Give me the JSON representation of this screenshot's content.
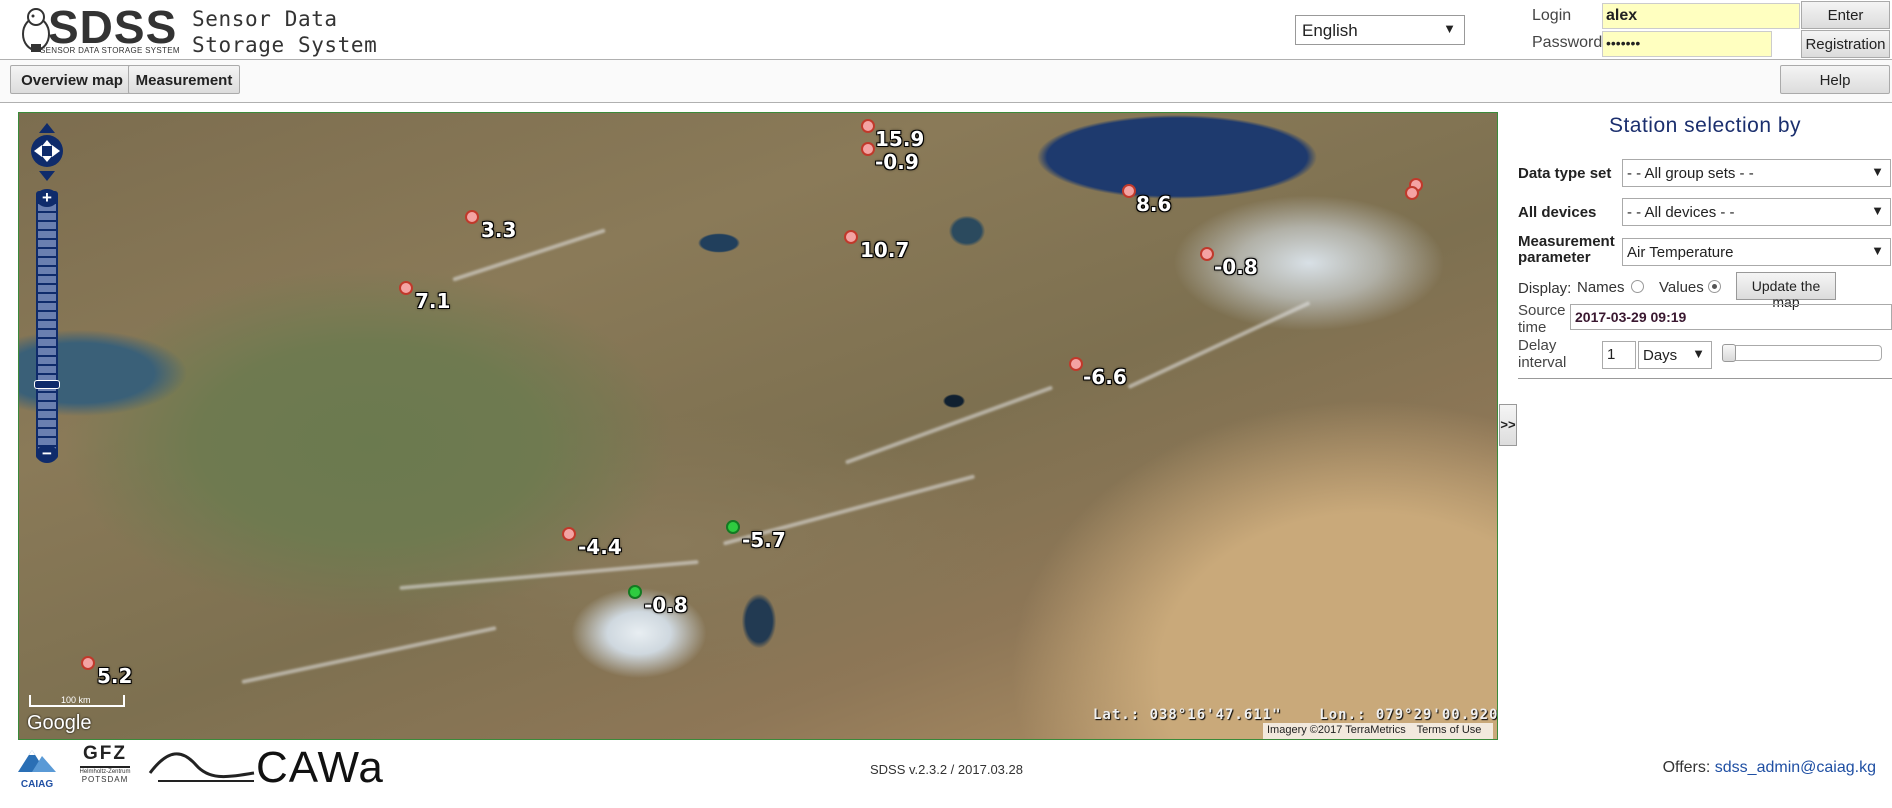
{
  "header": {
    "logo_text": "SDSS",
    "logo_subtext": "SENSOR DATA STORAGE SYSTEM",
    "title_line1": "Sensor Data",
    "title_line2": "Storage System",
    "language": "English",
    "login_label": "Login",
    "password_label": "Password",
    "login_value": "alex",
    "password_value": "•••••••",
    "enter_label": "Enter",
    "registration_label": "Registration"
  },
  "toolbar": {
    "overview_label": "Overview map",
    "measurement_label": "Measurement",
    "help_label": "Help"
  },
  "map": {
    "stations": [
      {
        "value": "15.9",
        "color": "red"
      },
      {
        "value": "-0.9",
        "color": "red"
      },
      {
        "value": "8.6",
        "color": "red"
      },
      {
        "value": "3.3",
        "color": "red"
      },
      {
        "value": "10.7",
        "color": "red"
      },
      {
        "value": "7.1",
        "color": "red"
      },
      {
        "value": "-0.8",
        "color": "red"
      },
      {
        "value": "-6.6",
        "color": "red"
      },
      {
        "value": "-4.4",
        "color": "red"
      },
      {
        "value": "-5.7",
        "color": "green"
      },
      {
        "value": "-0.8",
        "color": "green"
      },
      {
        "value": "5.2",
        "color": "red"
      }
    ],
    "scale_label": "100 km",
    "google_label": "Google",
    "coordinates": "Lat.: 038°16'47.611\"    Lon.: 079°29'00.920\"",
    "imagery": "Imagery ©2017 TerraMetrics",
    "terms": "Terms of Use"
  },
  "panel": {
    "title": "Station selection by",
    "data_type_label": "Data type set",
    "data_type_value": "- - All group sets - -",
    "devices_label": "All devices",
    "devices_value": "- - All devices - -",
    "param_label_1": "Measurement",
    "param_label_2": "parameter",
    "param_value": "Air Temperature",
    "display_label": "Display:",
    "names_label": "Names",
    "values_label": "Values",
    "update_label": "Update the map",
    "source_label_1": "Source",
    "source_label_2": "time",
    "source_value": "2017-03-29 09:19",
    "delay_label_1": "Delay",
    "delay_label_2": "interval",
    "delay_value": "1",
    "delay_unit": "Days",
    "toggle_label": ">>"
  },
  "footer": {
    "caiag_label": "CAIAG",
    "gfz_label": "GFZ",
    "gfz_sub1": "Helmholtz-Zentrum",
    "gfz_sub2": "POTSDAM",
    "cawa_label": "CAWa",
    "version": "SDSS v.2.3.2 / 2017.03.28",
    "offers_label": "Offers:",
    "offers_email": "sdss_admin@caiag.kg"
  },
  "colors": {
    "accent": "#1b2f6e",
    "input_highlight": "#ffffc0",
    "station_red": "#f4a3a3",
    "station_green": "#2ecc40",
    "link": "#1f4fa3"
  }
}
